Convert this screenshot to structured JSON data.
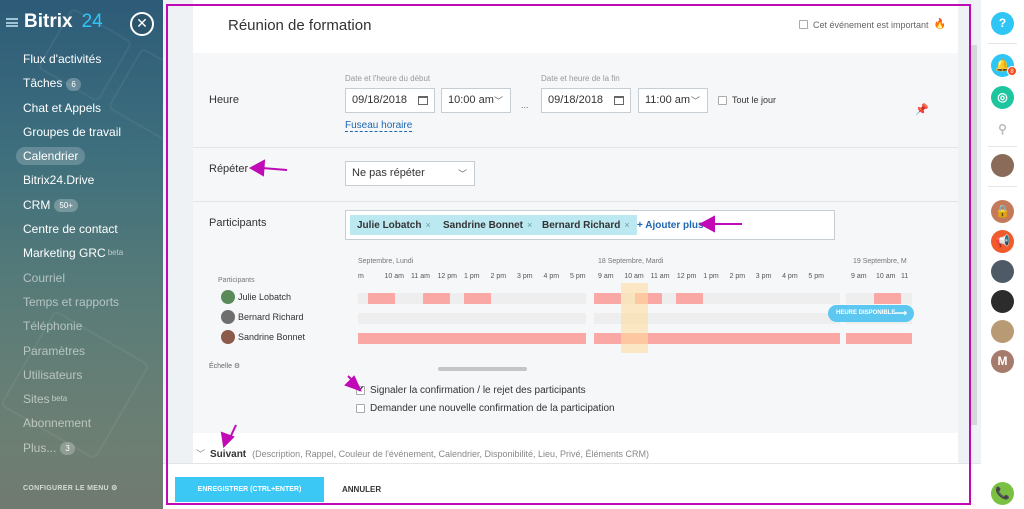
{
  "sidebar": {
    "brand_name": "Bitrix",
    "brand_number": "24",
    "items": [
      {
        "label": "Flux d'activités",
        "count": "",
        "sup": ""
      },
      {
        "label": "Tâches",
        "count": "6",
        "sup": ""
      },
      {
        "label": "Chat et Appels",
        "count": "",
        "sup": ""
      },
      {
        "label": "Groupes de travail",
        "count": "",
        "sup": ""
      },
      {
        "label": "Calendrier",
        "count": "",
        "sup": "",
        "active": true
      },
      {
        "label": "Bitrix24.Drive",
        "count": "",
        "sup": ""
      },
      {
        "label": "CRM",
        "count": "50+",
        "sup": ""
      },
      {
        "label": "Centre de contact",
        "count": "",
        "sup": ""
      },
      {
        "label": "Marketing GRC",
        "count": "",
        "sup": "beta"
      },
      {
        "label": "Courriel",
        "count": "",
        "sup": ""
      },
      {
        "label": "Temps et rapports",
        "count": "",
        "sup": ""
      },
      {
        "label": "Téléphonie",
        "count": "",
        "sup": ""
      },
      {
        "label": "Paramètres",
        "count": "",
        "sup": ""
      },
      {
        "label": "Utilisateurs",
        "count": "",
        "sup": ""
      },
      {
        "label": "Sites",
        "count": "",
        "sup": "beta"
      },
      {
        "label": "Abonnement",
        "count": "",
        "sup": ""
      },
      {
        "label": "Plus...",
        "count": "3",
        "sup": ""
      }
    ],
    "configure_label": "CONFIGURER LE MENU"
  },
  "event": {
    "title": "Réunion de formation",
    "important_label": "Cet événement est important"
  },
  "time": {
    "row_label": "Heure",
    "start_label": "Date et l'heure du début",
    "end_label": "Date et heure de la fin",
    "start_date": "09/18/2018",
    "start_time": "10:00 am",
    "separator": "...",
    "end_date": "09/18/2018",
    "end_time": "11:00 am",
    "all_day_label": "Tout le jour",
    "timezone_link": "Fuseau horaire"
  },
  "repeat": {
    "row_label": "Répéter",
    "value": "Ne pas répéter"
  },
  "participants": {
    "row_label": "Participants",
    "tags": [
      "Julie Lobatch",
      "Sandrine Bonnet",
      "Bernard Richard"
    ],
    "add_more": "+ Ajouter plus",
    "header_label": "Participants",
    "list": [
      "Julie Lobatch",
      "Bernard Richard",
      "Sandrine Bonnet"
    ],
    "days": [
      "Septembre, Lundi",
      "18 Septembre, Mardi",
      "19 Septembre, M"
    ],
    "hours_day1": [
      "m",
      "10 am",
      "11 am",
      "12 pm",
      "1 pm",
      "2 pm",
      "3 pm",
      "4 pm",
      "5 pm"
    ],
    "hours_day2": [
      "9 am",
      "10 am",
      "11 am",
      "12 pm",
      "1 pm",
      "2 pm",
      "3 pm",
      "4 pm",
      "5 pm"
    ],
    "hours_day3": [
      "9 am",
      "10 am",
      "11"
    ],
    "available_label": "HEURE DISPONIBLE",
    "scale_label": "Échelle"
  },
  "options": {
    "notify_label": "Signaler la confirmation / le rejet des participants",
    "notify_checked": true,
    "reconfirm_label": "Demander une nouvelle confirmation de la participation",
    "reconfirm_checked": false
  },
  "more": {
    "label": "Suivant",
    "details": "(Description, Rappel, Couleur de l'événement, Calendrier, Disponibilité, Lieu, Privé, Éléments CRM)"
  },
  "footer": {
    "save_label": "ENREGISTRER (CTRL+ENTER)",
    "cancel_label": "ANNULER"
  },
  "right_bar": {
    "help_glyph": "?",
    "notif_badge": "8",
    "avatar_initial": "M"
  },
  "colors": {
    "accent": "#3bc8f5",
    "busy": "#f9a8a6",
    "annotation": "#c00ab6",
    "link": "#2067b0"
  }
}
